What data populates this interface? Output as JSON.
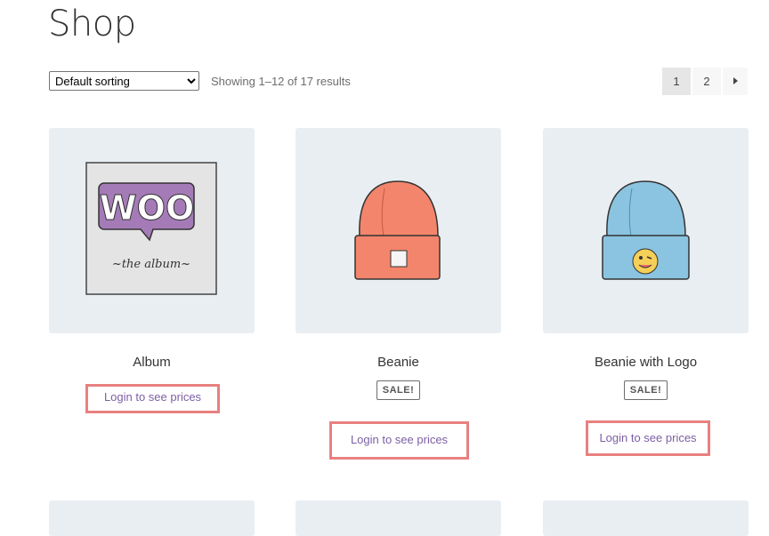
{
  "page": {
    "title": "Shop"
  },
  "toolbar": {
    "sort_selected": "Default sorting",
    "result_count": "Showing 1–12 of 17 results"
  },
  "pagination": {
    "pages": [
      "1",
      "2"
    ],
    "current": "1",
    "next_icon": "chevron-right-icon"
  },
  "products": [
    {
      "name": "Album",
      "sale": "",
      "login_text": "Login to see prices",
      "image": "woo-album-icon"
    },
    {
      "name": "Beanie",
      "sale": "SALE!",
      "login_text": "Login to see prices",
      "image": "orange-beanie-icon"
    },
    {
      "name": "Beanie with Logo",
      "sale": "SALE!",
      "login_text": "Login to see prices",
      "image": "blue-beanie-logo-icon"
    }
  ],
  "colors": {
    "thumb_bg": "#e9eef2",
    "link": "#7c5fa4",
    "highlight_border": "#e88080"
  }
}
